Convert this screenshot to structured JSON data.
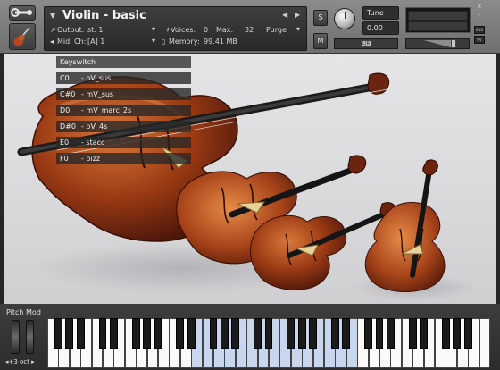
{
  "header": {
    "title": "Violin - basic",
    "output_label": "Output:",
    "output_value": "st. 1",
    "voices_label": "Voices:",
    "voices_value": "0",
    "max_label": "Max:",
    "max_value": "32",
    "purge_label": "Purge",
    "midi_label": "Midi Ch:",
    "midi_value": "[A]  1",
    "memory_label": "Memory:",
    "memory_value": "99.41 MB",
    "solo_label": "S",
    "mute_label": "M",
    "tune_label": "Tune",
    "tune_value": "0.00",
    "pan_handle": "L|R",
    "side_aux": "AUX",
    "side_pv": "PV",
    "close": "x",
    "minus": "–"
  },
  "keyswitch": {
    "header": "Keyswitch",
    "items": [
      {
        "note": "C0",
        "name": "- oV_sus"
      },
      {
        "note": "C#0",
        "name": "- mV_sus"
      },
      {
        "note": "D0",
        "name": "- mV_marc_2s"
      },
      {
        "note": "D#0",
        "name": "- pV_4s"
      },
      {
        "note": "E0",
        "name": "- stacc"
      },
      {
        "note": "F0",
        "name": "- pizz"
      }
    ]
  },
  "footer": {
    "pitch_mod_label": "Pitch Mod",
    "octave_label": "◂+3 oct ▸"
  },
  "keyboard": {
    "white_keys": 40,
    "highlight_start": 13,
    "highlight_end": 28,
    "start_note": "F"
  },
  "colors": {
    "header_bg": "#7d7d7d",
    "panel_bg": "#2c2c2c",
    "art_bg": "#dcdcde",
    "wood": "#7a2a10",
    "key_highlight": "#c8d6ee"
  },
  "icons": [
    "wrench-icon",
    "violin-icon",
    "dropdown-icon",
    "arrow-left-icon",
    "arrow-right-icon",
    "tune-knob",
    "close-icon"
  ]
}
